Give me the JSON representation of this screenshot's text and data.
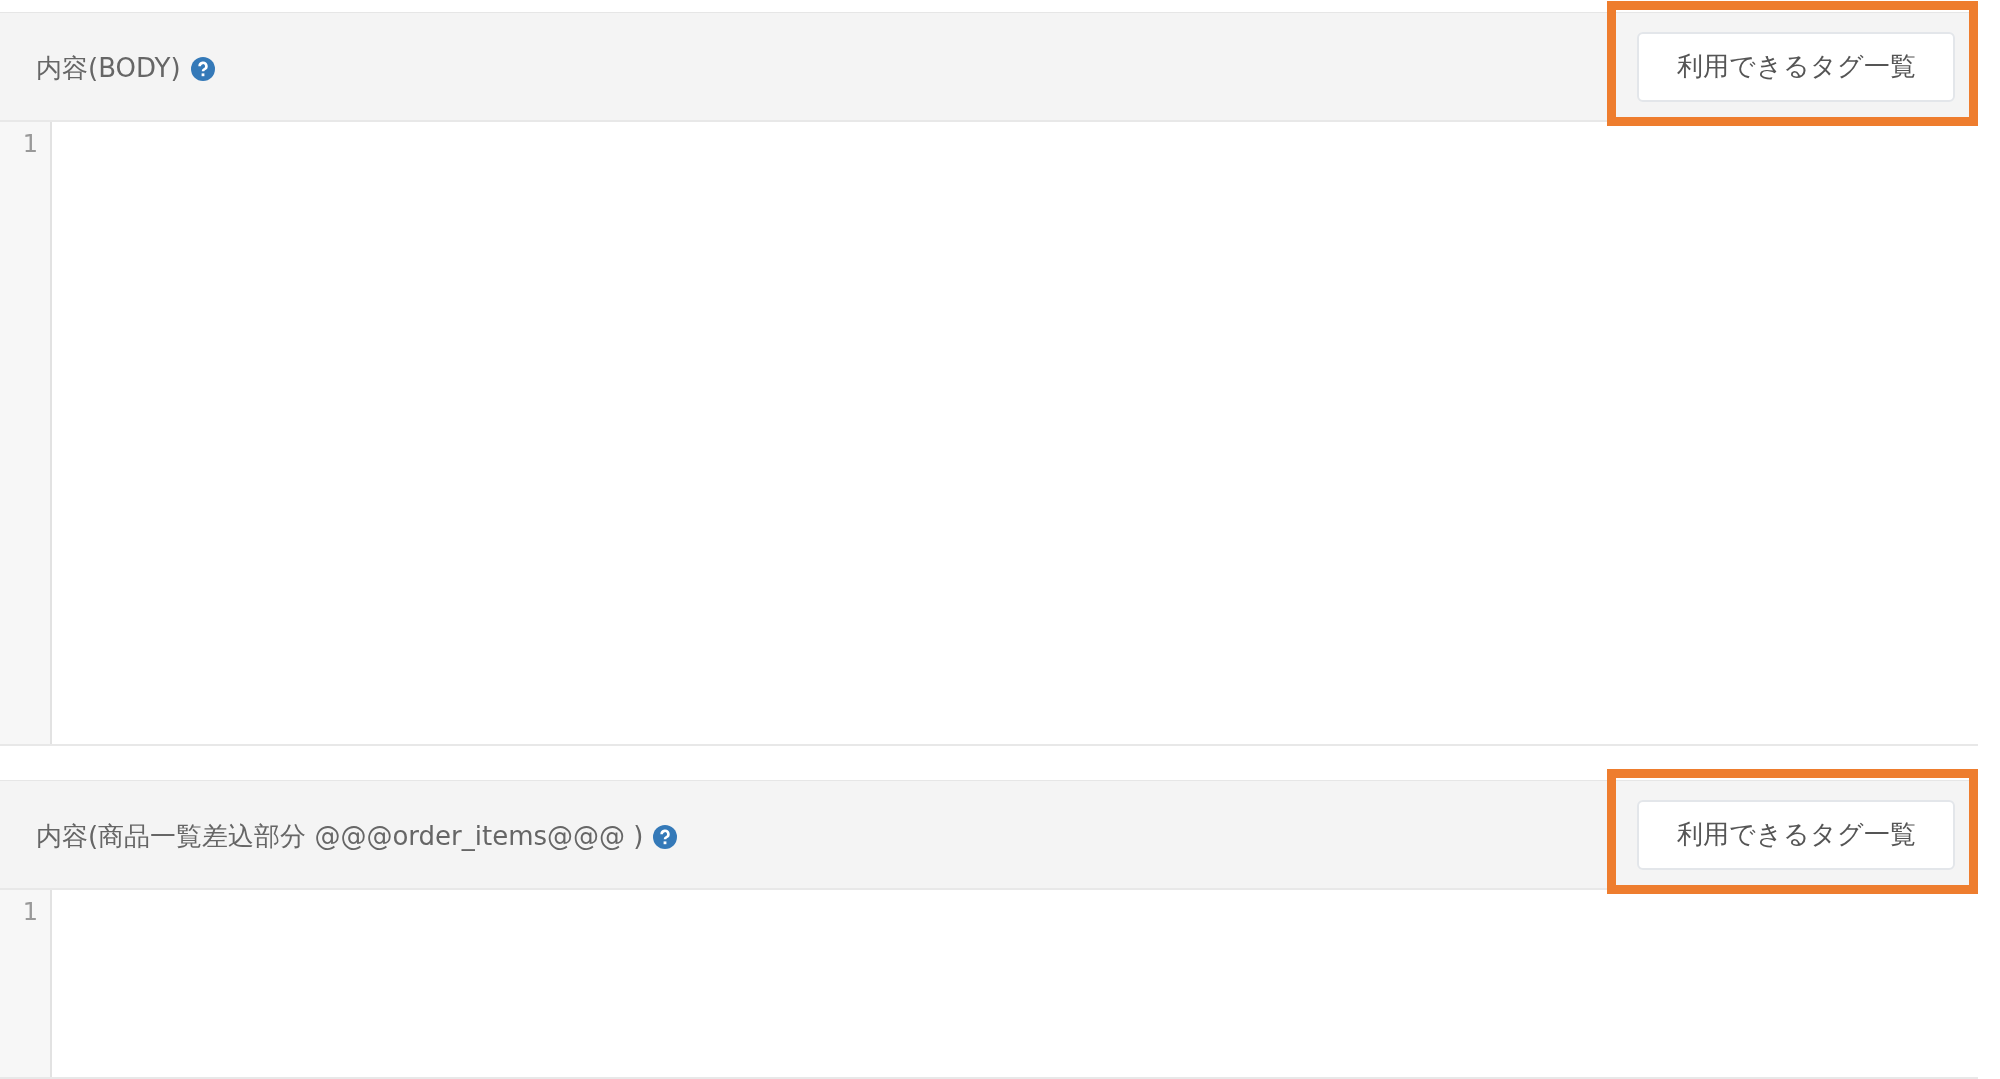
{
  "sections": [
    {
      "label": "内容(BODY)",
      "help": true,
      "button": "利用できるタグ一覧",
      "highlighted": true,
      "line_numbers": [
        "1"
      ]
    },
    {
      "label": "内容(商品一覧差込部分 @@@order_items@@@ )",
      "help": true,
      "button": "利用できるタグ一覧",
      "highlighted": true,
      "line_numbers": [
        "1"
      ]
    }
  ]
}
